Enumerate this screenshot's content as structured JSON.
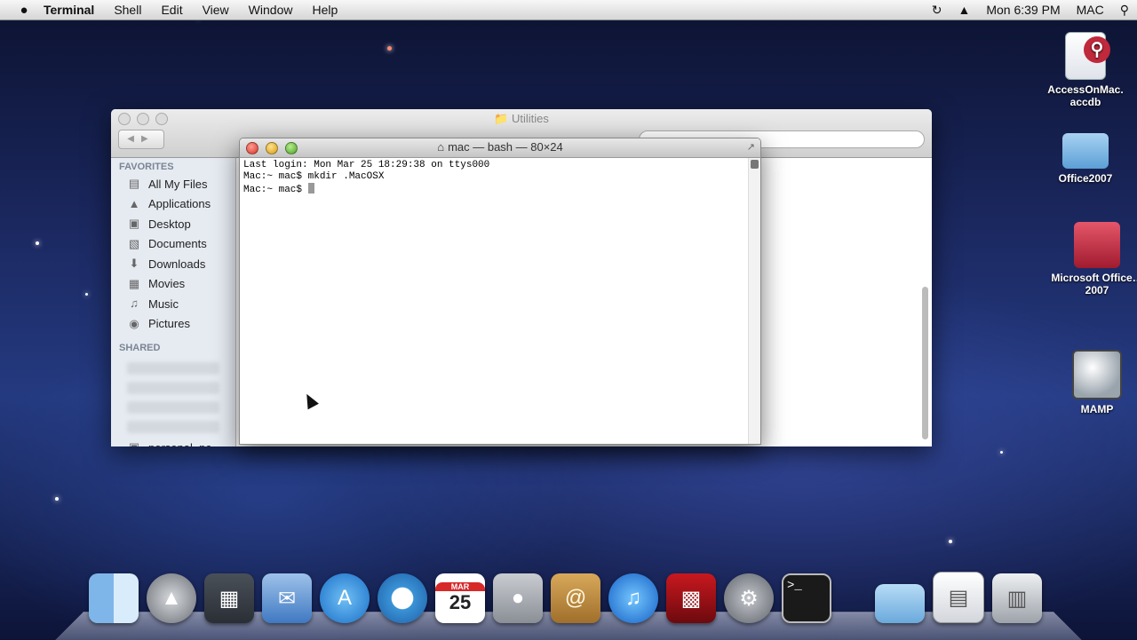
{
  "menubar": {
    "apple": "",
    "app_name": "Terminal",
    "menus": [
      "Shell",
      "Edit",
      "View",
      "Window",
      "Help"
    ],
    "clock": "Mon 6:39 PM",
    "user": "MAC"
  },
  "desktop": {
    "icons": [
      {
        "label": "AccessOnMac.\naccdb",
        "icon": "access-document-icon"
      },
      {
        "label": "Office2007",
        "icon": "folder-icon"
      },
      {
        "label": "Microsoft Office…2007",
        "icon": "microsoft-office-icon"
      },
      {
        "label": "MAMP",
        "icon": "mamp-elephant-icon"
      }
    ]
  },
  "finder": {
    "title": "Utilities",
    "favorites_header": "FAVORITES",
    "favorites": [
      {
        "label": "All My Files",
        "icon": "all-files-icon"
      },
      {
        "label": "Applications",
        "icon": "applications-icon"
      },
      {
        "label": "Desktop",
        "icon": "desktop-icon"
      },
      {
        "label": "Documents",
        "icon": "documents-icon"
      },
      {
        "label": "Downloads",
        "icon": "downloads-icon"
      },
      {
        "label": "Movies",
        "icon": "movies-icon"
      },
      {
        "label": "Music",
        "icon": "music-icon"
      },
      {
        "label": "Pictures",
        "icon": "pictures-icon"
      }
    ],
    "shared_header": "SHARED",
    "shared_last": "personal_pc"
  },
  "terminal": {
    "title": "mac — bash — 80×24",
    "lines": [
      "Last login: Mon Mar 25 18:29:38 on ttys000",
      "Mac:~ mac$ mkdir .MacOSX",
      "Mac:~ mac$ "
    ]
  },
  "dock": {
    "calendar_month": "MAR",
    "calendar_day": "25",
    "terminal_prompt": ">_",
    "items": [
      "finder-icon",
      "launchpad-icon",
      "dashboard-icon",
      "mail-icon",
      "app-store-icon",
      "safari-icon",
      "calendar-icon",
      "facetime-icon",
      "contacts-icon",
      "itunes-icon",
      "photo-booth-icon",
      "system-preferences-icon",
      "terminal-icon",
      "folder-icon",
      "document-icon",
      "trash-icon"
    ]
  }
}
